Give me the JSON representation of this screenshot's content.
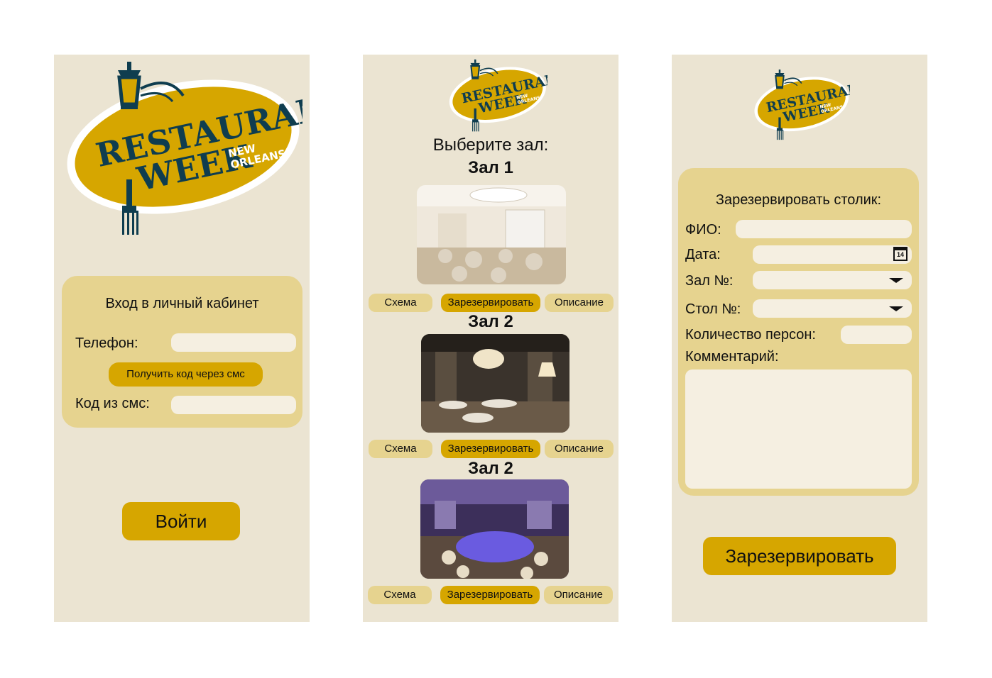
{
  "colors": {
    "screen_bg": "#ebe4d2",
    "card_bg": "#e6d38f",
    "accent": "#d6a600",
    "field_bg": "#f5efe1",
    "logo_navy": "#0f3d4f",
    "logo_gold": "#d6a600"
  },
  "logo": {
    "line1": "RESTAURANT",
    "line2": "WEEK",
    "line3": "NEW",
    "line4": "ORLEANS"
  },
  "login": {
    "title": "Вход в личный кабинет",
    "phone_label": "Телефон:",
    "phone_value": "",
    "sms_button": "Получить код через смс",
    "code_label": "Код из смс:",
    "code_value": "",
    "submit": "Войти"
  },
  "halls": {
    "heading": "Выберите зал:",
    "items": [
      {
        "title": "Зал 1",
        "photo": "bright-white-banquet-hall",
        "scheme": "Схема",
        "reserve": "Зарезервировать",
        "description": "Описание"
      },
      {
        "title": "Зал 2",
        "photo": "dark-chandelier-hall",
        "scheme": "Схема",
        "reserve": "Зарезервировать",
        "description": "Описание"
      },
      {
        "title": "Зал 2",
        "photo": "purple-lit-hall",
        "scheme": "Схема",
        "reserve": "Зарезервировать",
        "description": "Описание"
      }
    ]
  },
  "booking": {
    "title": "Зарезервировать столик:",
    "fio_label": "ФИО:",
    "date_label": "Дата:",
    "calendar_icon": "calendar-icon",
    "calendar_day": "14",
    "hall_label": "Зал №:",
    "table_label": "Стол №:",
    "persons_label": "Количество персон:",
    "comment_label": "Комментарий:",
    "submit": "Зарезервировать"
  }
}
